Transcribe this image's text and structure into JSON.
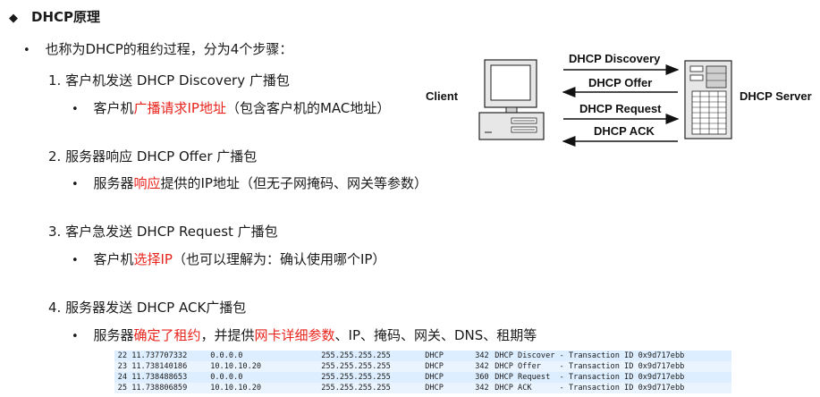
{
  "title": "DHCP原理",
  "intro": "也称为DHCP的租约过程，分为4个步骤：",
  "steps": [
    {
      "number": "1.",
      "heading": "客户机发送 DHCP Discovery 广播包",
      "detail": [
        {
          "text": "客户机",
          "red": false
        },
        {
          "text": "广播请求IP地址",
          "red": true
        },
        {
          "text": "（包含客户机的MAC地址）",
          "red": false
        }
      ]
    },
    {
      "number": "2.",
      "heading": "服务器响应 DHCP Offer 广播包",
      "detail": [
        {
          "text": "服务器",
          "red": false
        },
        {
          "text": "响应",
          "red": true
        },
        {
          "text": "提供的IP地址（但无子网掩码、网关等参数）",
          "red": false
        }
      ]
    },
    {
      "number": "3.",
      "heading": "客户急发送 DHCP Request 广播包",
      "detail": [
        {
          "text": "客户机",
          "red": false
        },
        {
          "text": "选择IP",
          "red": true
        },
        {
          "text": "（也可以理解为：确认使用哪个IP）",
          "red": false
        }
      ]
    },
    {
      "number": "4.",
      "heading": "服务器发送 DHCP ACK广播包",
      "detail": [
        {
          "text": "服务器",
          "red": false
        },
        {
          "text": "确定了租约",
          "red": true
        },
        {
          "text": "，并提供",
          "red": false
        },
        {
          "text": "网卡详细参数",
          "red": true
        },
        {
          "text": "、IP、掩码、网关、DNS、租期等",
          "red": false
        }
      ]
    }
  ],
  "diagram": {
    "client_label": "Client",
    "server_label": "DHCP Server",
    "messages": [
      {
        "label": "DHCP Discovery",
        "direction": "right"
      },
      {
        "label": "DHCP Offer",
        "direction": "left"
      },
      {
        "label": "DHCP Request",
        "direction": "right"
      },
      {
        "label": "DHCP ACK",
        "direction": "left"
      }
    ]
  },
  "packets": [
    {
      "no": "22",
      "time": "11.737707332",
      "src": "0.0.0.0",
      "dst": "255.255.255.255",
      "proto": "DHCP",
      "len": "342",
      "info": "DHCP Discover - Transaction ID 0x9d717ebb"
    },
    {
      "no": "23",
      "time": "11.738140186",
      "src": "10.10.10.20",
      "dst": "255.255.255.255",
      "proto": "DHCP",
      "len": "342",
      "info": "DHCP Offer    - Transaction ID 0x9d717ebb"
    },
    {
      "no": "24",
      "time": "11.738488653",
      "src": "0.0.0.0",
      "dst": "255.255.255.255",
      "proto": "DHCP",
      "len": "360",
      "info": "DHCP Request  - Transaction ID 0x9d717ebb"
    },
    {
      "no": "25",
      "time": "11.738806859",
      "src": "10.10.10.20",
      "dst": "255.255.255.255",
      "proto": "DHCP",
      "len": "342",
      "info": "DHCP ACK      - Transaction ID 0x9d717ebb"
    }
  ]
}
